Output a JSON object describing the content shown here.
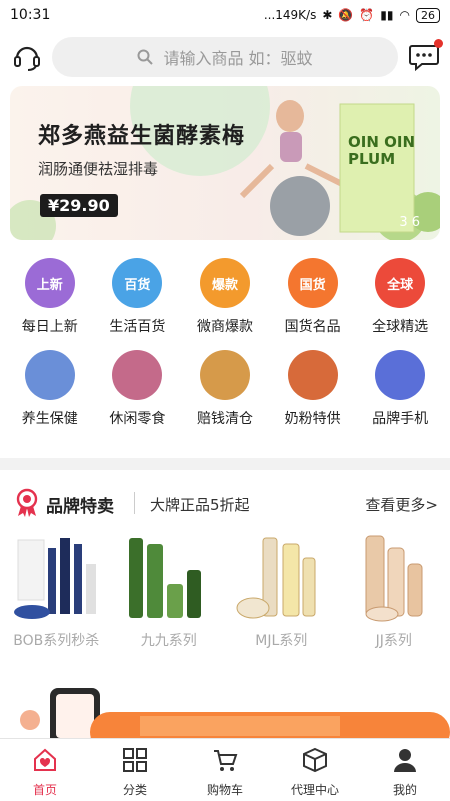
{
  "status_bar": {
    "time": "10:31",
    "net_speed": "...149K/s",
    "battery": "26"
  },
  "search": {
    "placeholder": "请输入商品 如：驱蚊"
  },
  "banner": {
    "title": "郑多燕益生菌酵素梅",
    "subtitle": "润肠通便祛湿排毒",
    "price": "¥29.90",
    "box_text_1": "OIN OIN",
    "box_text_2": "PLUM",
    "pager": "3  6"
  },
  "categories": [
    {
      "label": "每日上新",
      "badge": "上新",
      "color": "#9b6bd6"
    },
    {
      "label": "生活百货",
      "badge": "百货",
      "color": "#4aa3e6"
    },
    {
      "label": "微商爆款",
      "badge": "爆款",
      "color": "#f39a2d"
    },
    {
      "label": "国货名品",
      "badge": "国货",
      "color": "#f4762f"
    },
    {
      "label": "全球精选",
      "badge": "全球",
      "color": "#ec4a3a"
    },
    {
      "label": "养生保健",
      "color": "#6a8fd8"
    },
    {
      "label": "休闲零食",
      "color": "#c46a8a"
    },
    {
      "label": "赔钱清仓",
      "color": "#d69a4a"
    },
    {
      "label": "奶粉特供",
      "color": "#d76a3a"
    },
    {
      "label": "品牌手机",
      "color": "#5a6fd8"
    }
  ],
  "brand": {
    "title": "品牌特卖",
    "subtitle": "大牌正品5折起",
    "more": "查看更多>"
  },
  "products": [
    {
      "label": "BOB系列秒杀"
    },
    {
      "label": "九九系列"
    },
    {
      "label": "MJL系列"
    },
    {
      "label": "JJ系列"
    }
  ],
  "tabs": [
    {
      "label": "首页",
      "icon": "home-icon"
    },
    {
      "label": "分类",
      "icon": "category-grid-icon"
    },
    {
      "label": "购物车",
      "icon": "cart-icon"
    },
    {
      "label": "代理中心",
      "icon": "box-icon"
    },
    {
      "label": "我的",
      "icon": "user-icon"
    }
  ],
  "colors": {
    "accent": "#e4324e",
    "promo_orange": "#f7843a"
  }
}
